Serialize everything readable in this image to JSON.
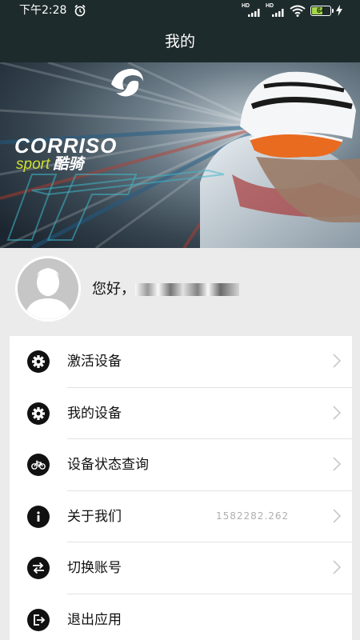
{
  "status_bar": {
    "time": "下午2:28",
    "signal1_label": "HD",
    "signal2_label": "HD",
    "battery_level": "64"
  },
  "header": {
    "title": "我的"
  },
  "banner": {
    "brand_main": "CORRISO",
    "brand_sub": "sport",
    "brand_cn": "酷骑"
  },
  "user": {
    "greeting": "您好，",
    "phone_masked": "1302226761"
  },
  "menu": {
    "items": [
      {
        "label": "激活设备",
        "icon": "gear-icon"
      },
      {
        "label": "我的设备",
        "icon": "gear-icon"
      },
      {
        "label": "设备状态查询",
        "icon": "bicycle-icon"
      },
      {
        "label": "关于我们",
        "icon": "info-icon",
        "value": "1582282.262"
      },
      {
        "label": "切换账号",
        "icon": "switch-icon"
      },
      {
        "label": "退出应用",
        "icon": "exit-icon"
      }
    ]
  },
  "colors": {
    "header_bg": "#1e2b2c",
    "page_bg": "#ebebeb",
    "battery_fill": "#a4d84a",
    "brand_accent": "#d2e02c"
  }
}
